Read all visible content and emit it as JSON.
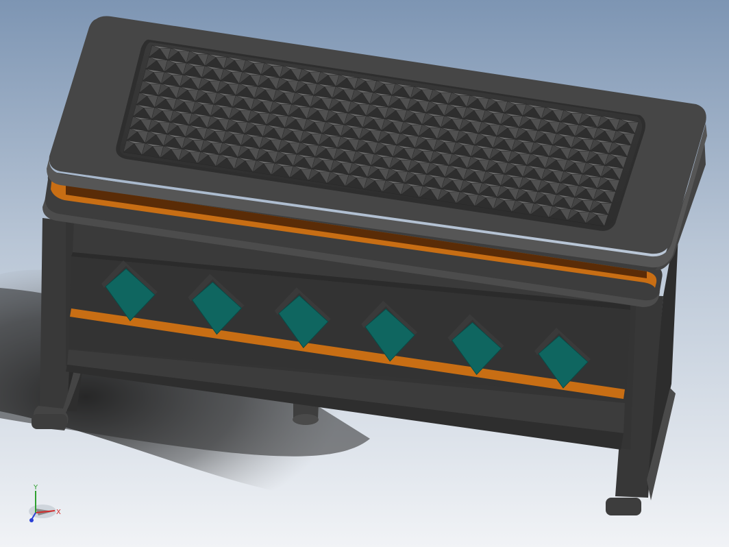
{
  "app": {
    "type": "CAD 3D model viewport"
  },
  "colors": {
    "background_top": "#7f97b5",
    "background_bottom": "#eef1f5",
    "body_dark": "#3b3b3b",
    "body_mid": "#454545",
    "body_light": "#555555",
    "orange_accent": "#c86e14",
    "orange_dark": "#5a2c07",
    "teal_block": "#0f6660",
    "teal_side": "#3a3a3a",
    "spike_light": "#6a6a6a",
    "spike_dark": "#2e2e2e"
  },
  "model": {
    "name": "",
    "teal_block_count": 6,
    "spike_rows": 9,
    "spike_cols": 26
  },
  "triad": {
    "x_label": "X",
    "y_label": "Y",
    "z_label": "",
    "x_color": "#d22b2b",
    "y_color": "#2fa02f",
    "z_color": "#2a3fd6"
  }
}
